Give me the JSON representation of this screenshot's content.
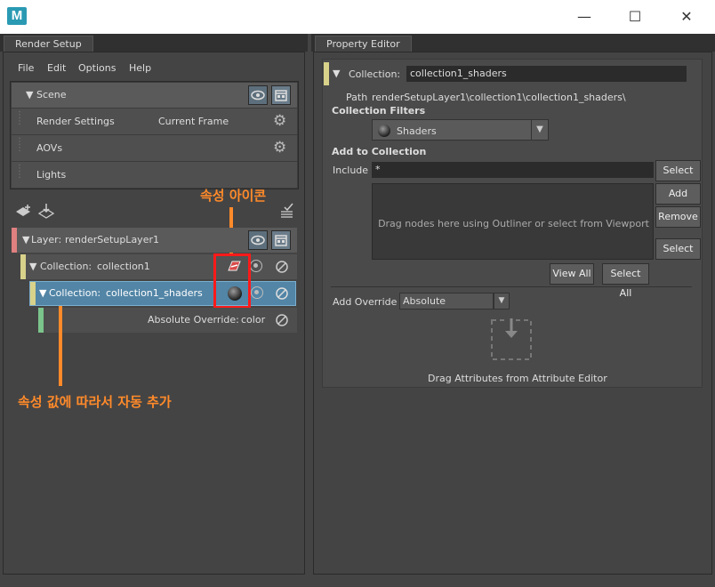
{
  "window": {
    "logo_text": "M",
    "minimize": "—",
    "maximize": "☐",
    "close": "✕"
  },
  "render_setup": {
    "tab_label": "Render Setup",
    "menu": [
      "File",
      "Edit",
      "Options",
      "Help"
    ],
    "scene": {
      "label": "Scene",
      "items": [
        {
          "label": "Render Settings",
          "value": "Current Frame"
        },
        {
          "label": "AOVs",
          "value": ""
        },
        {
          "label": "Lights",
          "value": ""
        }
      ]
    },
    "tree": {
      "layer": {
        "prefix": "Layer:",
        "name": "renderSetupLayer1"
      },
      "collection1": {
        "prefix": "Collection:",
        "name": "collection1"
      },
      "collection2": {
        "prefix": "Collection:",
        "name": "collection1_shaders"
      },
      "override": {
        "prefix": "Absolute Override:",
        "name": "color"
      }
    }
  },
  "property_editor": {
    "tab_label": "Property Editor",
    "collection_label": "Collection:",
    "collection_value": "collection1_shaders",
    "path_label": "Path",
    "path_value": "renderSetupLayer1\\collection1\\collection1_shaders\\",
    "filters_heading": "Collection Filters",
    "filter_value": "Shaders",
    "add_heading": "Add to Collection",
    "include_label": "Include",
    "include_value": "*",
    "drop_hint": "Drag nodes here using Outliner or select from Viewport",
    "buttons": {
      "select1": "Select",
      "add": "Add",
      "remove": "Remove",
      "select2": "Select",
      "view_all": "View All",
      "select_all": "Select All"
    },
    "add_override_label": "Add Override",
    "add_override_value": "Absolute",
    "drag_attr_hint": "Drag Attributes from Attribute Editor"
  },
  "annotations": {
    "attribute_icon": "속성 아이콘",
    "auto_added": "속성 값에 따라서 자동 추가"
  },
  "colors": {
    "accent_orange": "#ff8a2a",
    "highlight_red": "#ff1a1a",
    "selected_row": "#5285a6"
  }
}
